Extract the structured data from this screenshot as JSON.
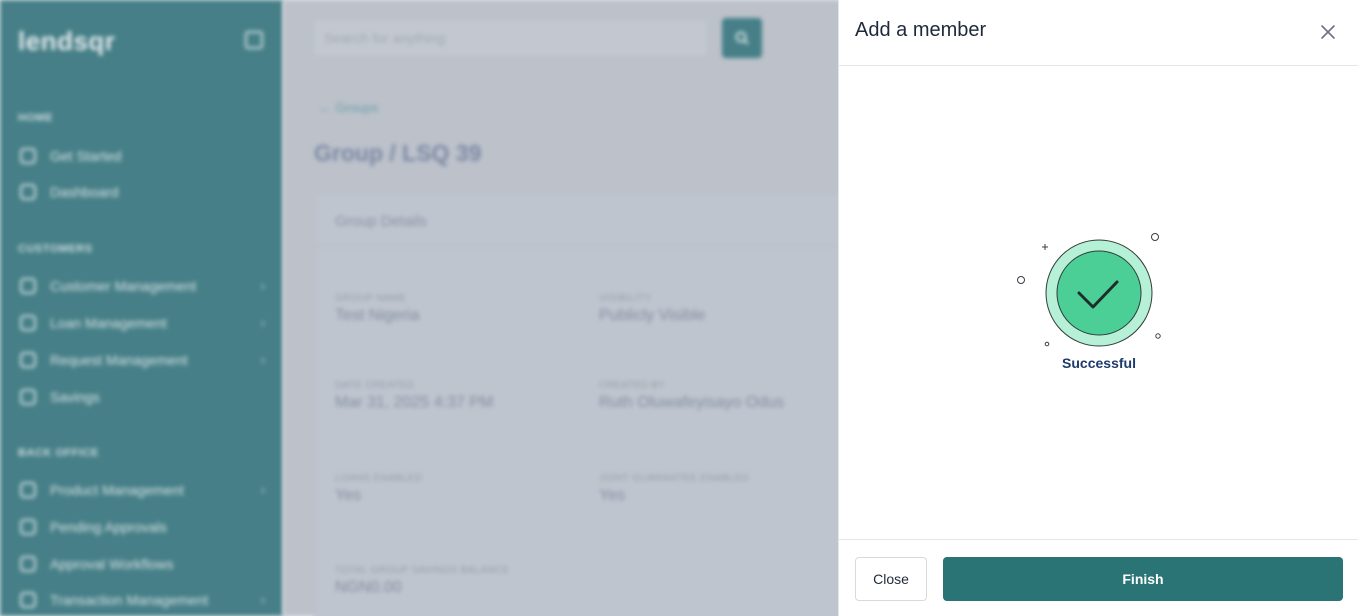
{
  "app": {
    "logo": "lendsqr"
  },
  "sidebar": {
    "sections": [
      {
        "label": "HOME",
        "items": [
          {
            "label": "Get Started"
          },
          {
            "label": "Dashboard"
          }
        ]
      },
      {
        "label": "CUSTOMERS",
        "items": [
          {
            "label": "Customer Management"
          },
          {
            "label": "Loan Management"
          },
          {
            "label": "Request Management"
          },
          {
            "label": "Savings"
          }
        ]
      },
      {
        "label": "BACK OFFICE",
        "items": [
          {
            "label": "Product Management"
          },
          {
            "label": "Pending Approvals"
          },
          {
            "label": "Approval Workflows"
          },
          {
            "label": "Transaction Management"
          }
        ]
      }
    ]
  },
  "header": {
    "search_placeholder": "Search for anything"
  },
  "page": {
    "back_label": "Groups",
    "title": "Group / LSQ 39",
    "card_title": "Group Details",
    "fields": [
      {
        "label": "GROUP NAME",
        "value": "Test Nigeria"
      },
      {
        "label": "VISIBILITY",
        "value": "Publicly Visible"
      },
      {
        "label": "DATE CREATED",
        "value": "Mar 31, 2025 4:37 PM"
      },
      {
        "label": "CREATED BY",
        "value": "Ruth Oluwafeyisayo Odus"
      },
      {
        "label": "LOANS ENABLED",
        "value": "Yes"
      },
      {
        "label": "JOINT GUARANTEE ENABLED",
        "value": "Yes"
      },
      {
        "label": "TOTAL GROUP SAVINGS BALANCE",
        "value": "NGN0.00"
      }
    ]
  },
  "drawer": {
    "title": "Add a member",
    "status_text": "Successful",
    "close_label": "Close",
    "finish_label": "Finish"
  },
  "colors": {
    "brand": "#2a7475",
    "success_green": "#4ccf97",
    "success_ring": "#b6f0d6",
    "status_text": "#1d3a6b"
  },
  "icons": [
    "close-icon",
    "search-icon",
    "check-icon",
    "back-arrow-icon"
  ]
}
